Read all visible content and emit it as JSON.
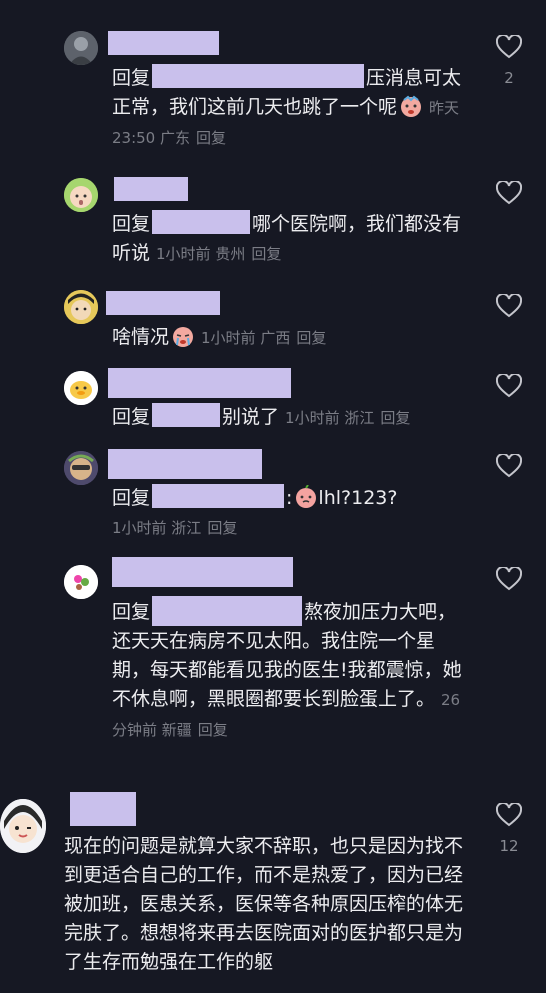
{
  "comments": [
    {
      "prefix": "回复",
      "text": "压消息可太正常，我们这前几天也跳了一个呢",
      "meta": "昨天 23:50 广东",
      "action": "回复",
      "likes": "2"
    },
    {
      "prefix": "回复",
      "text": "哪个医院啊，我们都没有听说",
      "meta": "1小时前 贵州",
      "action": "回复",
      "likes": ""
    },
    {
      "prefix": "",
      "text": "啥情况",
      "meta": "1小时前 广西",
      "action": "回复",
      "likes": ""
    },
    {
      "prefix": "回复",
      "text": "别说了",
      "meta": "1小时前 浙江",
      "action": "回复",
      "likes": ""
    },
    {
      "prefix": "回复",
      "text": "lhl?123?",
      "meta": "1小时前 浙江",
      "action": "回复",
      "likes": ""
    },
    {
      "prefix": "回复",
      "text": "熬夜加压力大吧，还天天在病房不见太阳。我住院一个星期，每天都能看见我的医生!我都震惊，她不休息啊，黑眼圈都要长到脸蛋上了。",
      "meta": "26分钟前 新疆",
      "action": "回复",
      "likes": ""
    },
    {
      "prefix": "",
      "text": "现在的问题是就算大家不辞职，也只是因为找不到更适合自己的工作，而不是热爱了，因为已经被加班，医患关系，医保等各种原因压榨的体无完肤了。想想将来再去医院面对的医护都只是为了生存而勉强在工作的躯",
      "meta": "",
      "action": "",
      "likes": "12"
    }
  ],
  "colors": {
    "background": "#161823",
    "redaction": "#c9c0ec",
    "text": "#ececef",
    "meta": "#7b7d86"
  },
  "icons": {
    "like": "heart-outline-icon"
  }
}
